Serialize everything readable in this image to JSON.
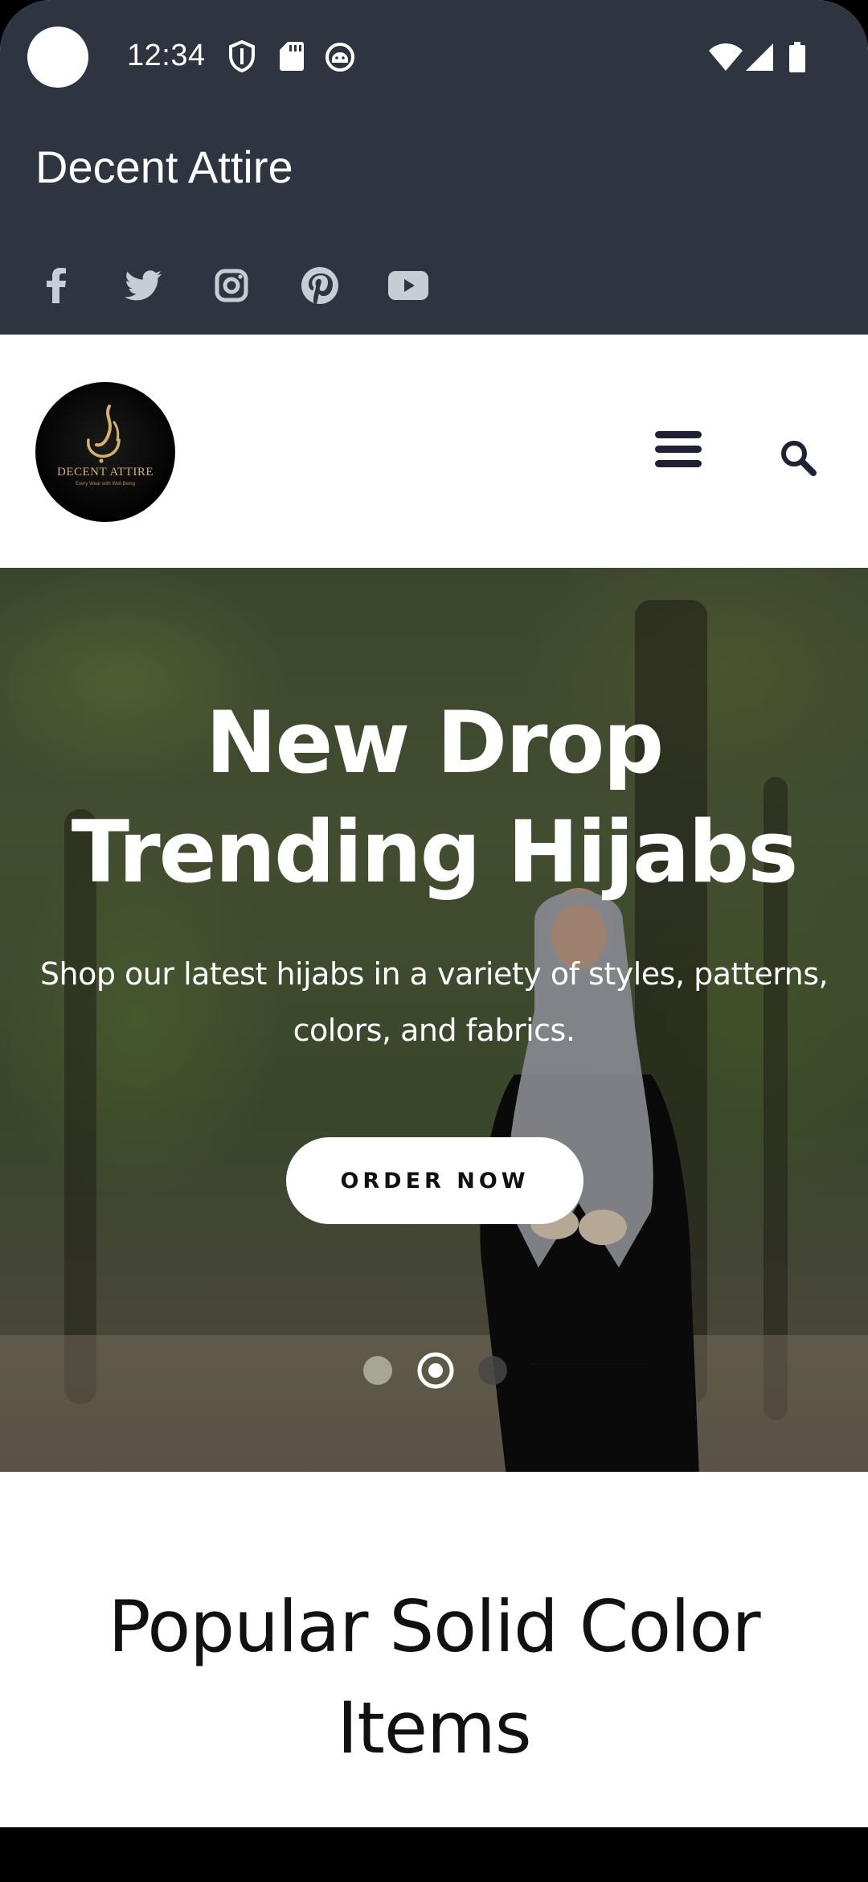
{
  "status_bar": {
    "time": "12:34",
    "icons": [
      "shield-icon",
      "sd-card-icon",
      "android-debug-icon",
      "wifi-icon",
      "cellular-signal-icon",
      "battery-icon"
    ]
  },
  "app_bar": {
    "title": "Decent Attire",
    "social_icons": [
      "facebook-icon",
      "twitter-icon",
      "instagram-icon",
      "pinterest-icon",
      "youtube-icon"
    ]
  },
  "header": {
    "logo_text": "DECENT ATTIRE",
    "logo_tagline": "Every Wear with Well Being"
  },
  "hero": {
    "title_line1": "New Drop",
    "title_line2": "Trending Hijabs",
    "subtitle": "Shop our latest hijabs in a variety of styles, patterns, colors, and fabrics.",
    "cta_label": "ORDER NOW",
    "slides": 3,
    "active_slide": 2
  },
  "section": {
    "title": "Popular Solid Color Items"
  },
  "colors": {
    "app_bar_bg": "#2e3440",
    "menu_icon": "#1f2235",
    "logo_gold": "#d4b26a"
  }
}
